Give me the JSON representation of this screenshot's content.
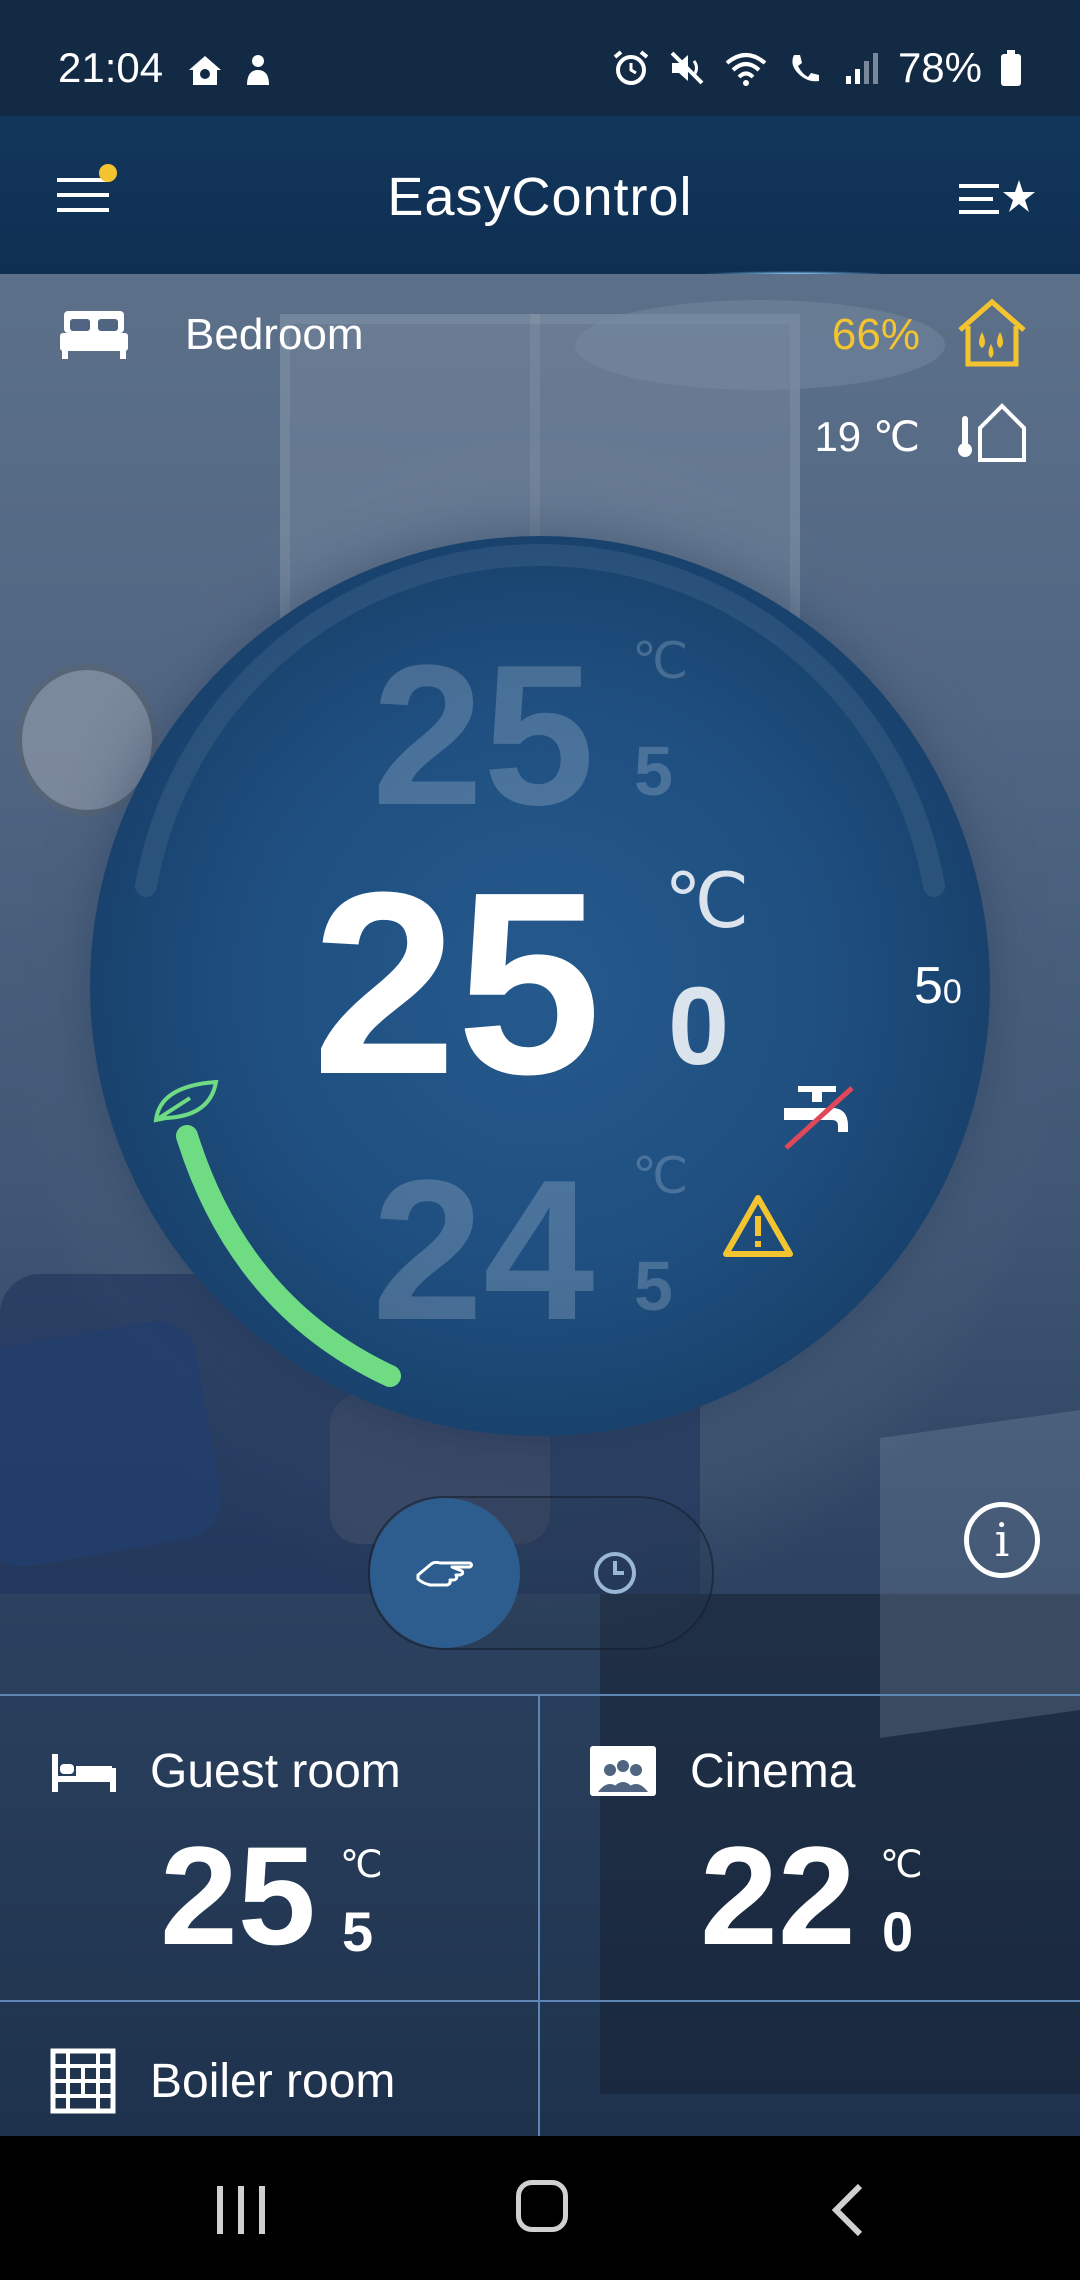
{
  "status_bar": {
    "time": "21:04",
    "battery": "78%",
    "icons": [
      "smart-home-icon",
      "notification-person-icon",
      "alarm-icon",
      "mute-icon",
      "wifi-icon",
      "wifi-call-icon",
      "signal-icon",
      "battery-icon"
    ]
  },
  "app_bar": {
    "title": "EasyControl",
    "menu_icon": "hamburger-menu-icon",
    "favorites_icon": "favorites-list-icon",
    "notification_dot_color": "#f4c430"
  },
  "current_room": {
    "name": "Bedroom",
    "icon": "bed-icon",
    "humidity": "66%",
    "humidity_icon": "humidity-house-icon",
    "outdoor_temp": "19 ℃",
    "outdoor_icon": "thermometer-house-icon"
  },
  "dial": {
    "above": {
      "int": "25",
      "unit": "℃",
      "dec": "5"
    },
    "current": {
      "int": "25",
      "unit": "℃",
      "dec": "0"
    },
    "below": {
      "int": "24",
      "unit": "℃",
      "dec": "5"
    },
    "side_value": {
      "int": "5",
      "dec": "0"
    },
    "eco_icon": "leaf-icon",
    "hot_water_off_icon": "tap-off-icon",
    "warning_icon": "warning-icon",
    "eco_arc_color": "#6fdc84",
    "warning_color": "#f4c430"
  },
  "mode": {
    "manual_icon": "hand-icon",
    "auto_icon": "clock-icon",
    "selected": "manual"
  },
  "info_icon": "info-icon",
  "rooms": [
    {
      "name": "Guest room",
      "icon": "bed-icon",
      "int": "25",
      "unit": "℃",
      "dec": "5"
    },
    {
      "name": "Cinema",
      "icon": "cinema-group-icon",
      "int": "22",
      "unit": "℃",
      "dec": "0"
    },
    {
      "name": "Boiler room",
      "icon": "boiler-grid-icon"
    }
  ],
  "nav_bar": {
    "recent_icon": "recent-apps-icon",
    "home_icon": "home-button-icon",
    "back_icon": "back-icon"
  }
}
